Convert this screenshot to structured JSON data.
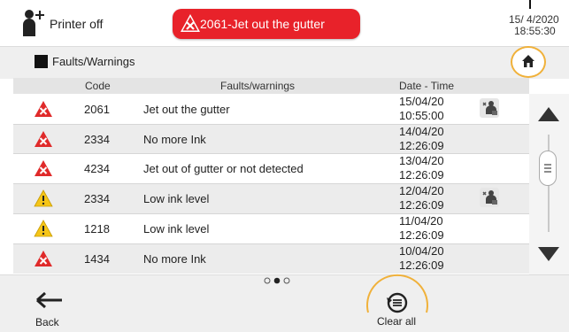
{
  "header": {
    "printer_status": "Printer off",
    "alert_text": "2061-Jet out the gutter",
    "date": "15/04/2020",
    "date_visible": "15/ 4/2020",
    "time": "18:55:30"
  },
  "subheader": {
    "title": "Faults/Warnings"
  },
  "table": {
    "columns": [
      "Code",
      "Faults/warnings",
      "Date - Time"
    ],
    "rows": [
      {
        "severity": "error",
        "code": "2061",
        "message": "Jet out the gutter",
        "date": "15/04/20",
        "time": "10:55:00",
        "technician": true
      },
      {
        "severity": "error",
        "code": "2334",
        "message": "No more Ink",
        "date": "14/04/20",
        "time": "12:26:09",
        "technician": false
      },
      {
        "severity": "error",
        "code": "4234",
        "message": "Jet out of gutter or not detected",
        "date": "13/04/20",
        "time": "12:26:09",
        "technician": false
      },
      {
        "severity": "warning",
        "code": "2334",
        "message": "Low ink level",
        "date": "12/04/20",
        "time": "12:26:09",
        "technician": true
      },
      {
        "severity": "warning",
        "code": "1218",
        "message": "Low ink level",
        "date": "11/04/20",
        "time": "12:26:09",
        "technician": false
      },
      {
        "severity": "error",
        "code": "1434",
        "message": "No more Ink",
        "date": "10/04/20",
        "time": "12:26:09",
        "technician": false
      }
    ]
  },
  "pagination": {
    "pages": 3,
    "current": 2
  },
  "footer": {
    "back_label": "Back",
    "clear_label": "Clear all"
  },
  "colors": {
    "alert_red": "#e8222a",
    "warning_yellow": "#f5c518",
    "error_red": "#e02a2a",
    "highlight_orange": "#f0b13a"
  }
}
